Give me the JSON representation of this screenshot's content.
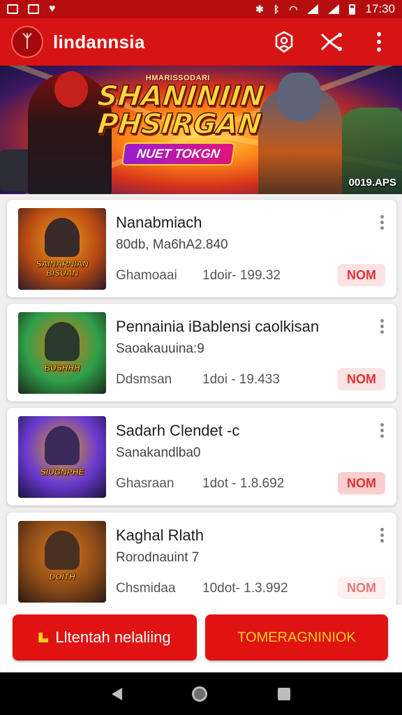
{
  "status_bar": {
    "time": "17:30",
    "icons": [
      "image-icon",
      "calendar-icon",
      "heart-icon",
      "bluetooth-icon",
      "bluetooth-icon",
      "wifi-icon",
      "signal-icon",
      "signal-icon",
      "battery-icon"
    ]
  },
  "app_bar": {
    "title": "lindannsia",
    "logo_glyph": "ᛉ",
    "actions": [
      "badge-icon",
      "share-icon",
      "more-vert-icon"
    ]
  },
  "banner": {
    "kicker": "HMARISSODARI",
    "title_line1": "SHANINIIN",
    "title_line2": "PHSIRGAN",
    "pill": "NUET TOKGN",
    "code": "0019.APS"
  },
  "list": {
    "items": [
      {
        "title": "Nanabmiach",
        "subtitle": "80db, Ma6hA2.840",
        "meta": "Ghamoaai",
        "date": "1doir- 199.32",
        "badge": "NOM",
        "thumb_caption": "SAINARNIAN BISUAN",
        "thumb_colors": [
          "#f0a020",
          "#b84a12",
          "#2a1a2a"
        ]
      },
      {
        "title": "Pennainia iBablensi caolkisan",
        "subtitle": "Saoakauuina:9",
        "meta": "Ddsmsan",
        "date": "1doi - 19.433",
        "badge": "NOM",
        "thumb_caption": "BUSHHH",
        "thumb_colors": [
          "#2fa04a",
          "#e07a1a",
          "#1a2a1a"
        ]
      },
      {
        "title": "Sadarh Clendet -c",
        "subtitle": "Sanakandlba0",
        "meta": "Ghasraan",
        "date": "1dot - 1.8.692",
        "badge": "NOM",
        "thumb_caption": "SIUGNPHE",
        "thumb_colors": [
          "#6a3ad0",
          "#e0a020",
          "#1a1440"
        ]
      },
      {
        "title": "Kaghal Rlath",
        "subtitle": "Rorodnauint 7",
        "meta": "Chsmidaa",
        "date": "10dot- 1.3.992",
        "badge": "NOM",
        "thumb_caption": "DOITH",
        "thumb_colors": [
          "#e07a1a",
          "#8a4a18",
          "#2a1a10"
        ]
      }
    ]
  },
  "bottom_actions": {
    "left_label": "Lltentah nelaliing",
    "right_label": "TOMERAGNINIOK"
  },
  "colors": {
    "status_bar": "#b50d0d",
    "app_bar": "#d71414",
    "accent": "#e01212",
    "badge_text": "#e03030",
    "badge_bg": "#fbe3e3"
  }
}
